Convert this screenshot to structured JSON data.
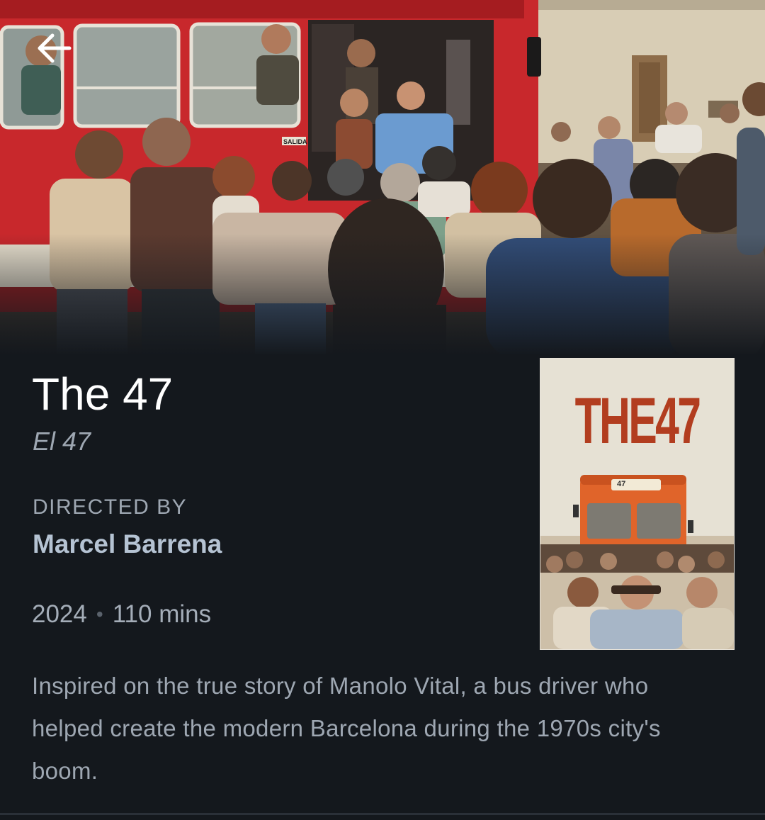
{
  "film": {
    "title": "The 47",
    "original_title": "El 47",
    "director_label": "DIRECTED BY",
    "director": "Marcel Barrena",
    "year": "2024",
    "separator": "•",
    "runtime": "110 mins",
    "synopsis": "Inspired on the true story of Manolo Vital, a bus driver who helped create the modern Barcelona during the 1970s city's boom."
  },
  "backdrop": {
    "bus_sign": "SALIDA"
  },
  "poster": {
    "title": "THE47",
    "bus_route_sign": "47"
  },
  "icons": {
    "back": "arrow-left-icon"
  },
  "colors": {
    "background": "#14181d",
    "title": "#ffffff",
    "secondary_text": "#9ea7b2",
    "director_link": "#b5c3d3",
    "bus_red": "#c8282c",
    "poster_title": "#b23d1f"
  }
}
